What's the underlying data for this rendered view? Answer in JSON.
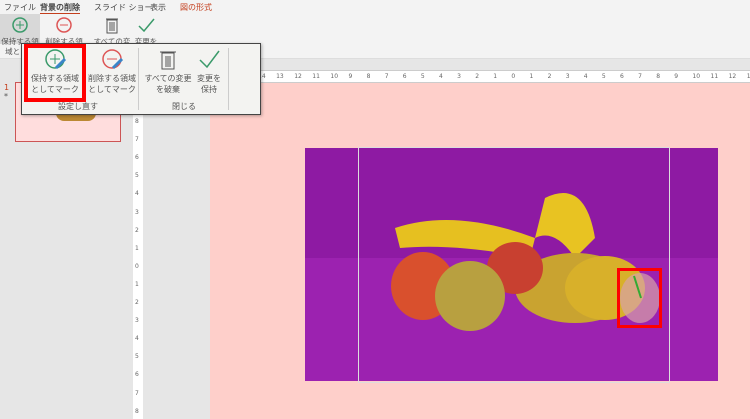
{
  "tabs": [
    {
      "label": "ファイル"
    },
    {
      "label": "背景の削除",
      "active": true
    },
    {
      "label": "スライド ショー"
    },
    {
      "label": "表示"
    },
    {
      "label": "図の形式",
      "color": "#c43e1c"
    }
  ],
  "ribbon": {
    "keep_label": "保持する領域として",
    "remove_label": "削除する領域",
    "discard_label": "すべての変更",
    "keep_changes_label": "変更を"
  },
  "popup": {
    "keep": {
      "line1": "保持する領域",
      "line2": "としてマーク"
    },
    "remove": {
      "line1": "削除する領域",
      "line2": "としてマーク"
    },
    "discard": {
      "line1": "すべての変更",
      "line2": "を破棄"
    },
    "keep_changes": {
      "line1": "変更を",
      "line2": "保持"
    },
    "group1": "設定し直す",
    "group2": "閉じる"
  },
  "slides": {
    "number": "1",
    "star": "*"
  },
  "rulers": {
    "horizontal_from": 14,
    "horizontal_to": 13,
    "vertical_from": 8,
    "vertical_to": -8
  },
  "colors": {
    "accent": "#c43e1c",
    "highlight": "#ff0000",
    "background_removed": "#a020b0",
    "slide": "#fecfca"
  },
  "icons": [
    "plus-pencil-icon",
    "minus-pencil-icon",
    "trash-icon",
    "checkmark-icon"
  ]
}
